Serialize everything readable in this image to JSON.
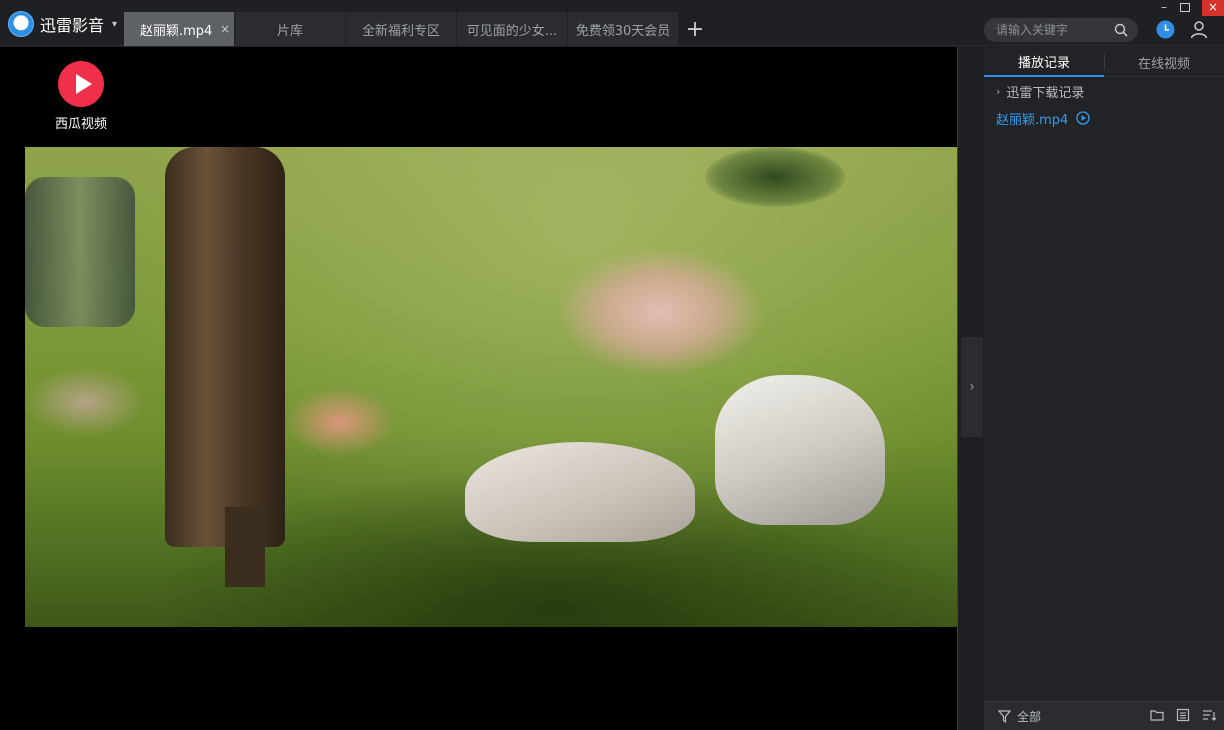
{
  "app": {
    "brand": "迅雷影音",
    "colors": {
      "accent": "#2f8ee6",
      "close": "#d4322b",
      "link": "#2f9ef0"
    }
  },
  "tabs": [
    {
      "label": "赵丽颖.mp4",
      "active": true,
      "close_label": "×"
    },
    {
      "label": "片库",
      "active": false
    },
    {
      "label": "全新福利专区",
      "active": false
    },
    {
      "label": "可见面的少女...",
      "active": false
    },
    {
      "label": "免费领30天会员",
      "active": false
    }
  ],
  "add_tab_label": "+",
  "search": {
    "placeholder": "请输入关键字",
    "value": ""
  },
  "window_controls": {
    "minimize": "–",
    "close": "×"
  },
  "player": {
    "watermark_text": "西瓜视频"
  },
  "panel": {
    "tabs": [
      {
        "label": "播放记录",
        "active": true
      },
      {
        "label": "在线视频",
        "active": false
      }
    ],
    "group_label": "迅雷下载记录",
    "items": [
      {
        "label": "赵丽颖.mp4"
      }
    ],
    "footer_label": "全部"
  },
  "icons": {
    "brand": "xunlei-logo-icon",
    "search": "search-icon",
    "history": "clock-icon",
    "user": "user-icon",
    "play": "play-circle-icon",
    "filter": "funnel-icon",
    "folder": "folder-icon",
    "list": "list-icon",
    "sort": "sort-icon",
    "collapse": "chevron-right-icon"
  }
}
